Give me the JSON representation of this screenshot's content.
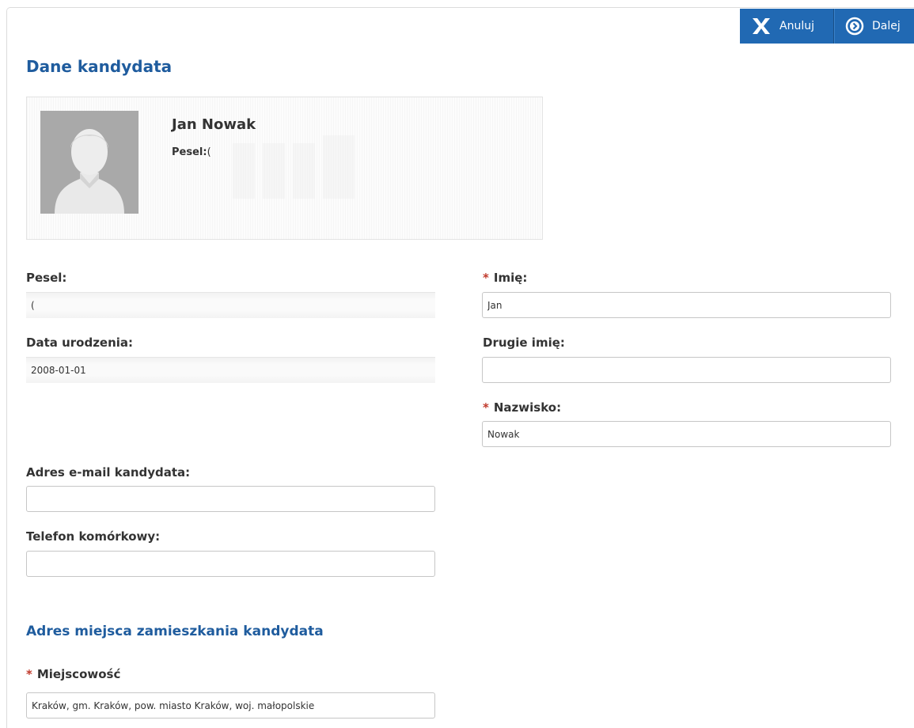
{
  "toolbar": {
    "cancel_label": "Anuluj",
    "next_label": "Dalej",
    "bg_color": "#2169b3"
  },
  "page": {
    "title": "Dane kandydata"
  },
  "profile": {
    "name": "Jan Nowak",
    "pesel_label": "Pesel:",
    "pesel_value": "("
  },
  "form": {
    "pesel": {
      "label": "Pesel:",
      "value": "("
    },
    "birth_date": {
      "label": "Data urodzenia:",
      "value": "2008-01-01"
    },
    "first_name": {
      "required_mark": "*",
      "label": "Imię:",
      "value": "Jan"
    },
    "second_name": {
      "label": "Drugie imię:",
      "value": ""
    },
    "last_name": {
      "required_mark": "*",
      "label": "Nazwisko:",
      "value": "Nowak"
    },
    "email": {
      "label": "Adres e-mail kandydata:",
      "value": ""
    },
    "phone": {
      "label": "Telefon komórkowy:",
      "value": ""
    }
  },
  "address": {
    "title": "Adres miejsca zamieszkania kandydata",
    "city": {
      "required_mark": "*",
      "label": "Miejscowość",
      "value": "Kraków, gm. Kraków, pow. miasto Kraków, woj. małopolskie"
    }
  },
  "colors": {
    "heading": "#1f5c9e",
    "required": "#c0392b",
    "accent": "#2169b3"
  },
  "icons": {
    "cancel": "close-icon",
    "next": "chevron-circle-right-icon",
    "avatar": "user-silhouette-icon"
  }
}
